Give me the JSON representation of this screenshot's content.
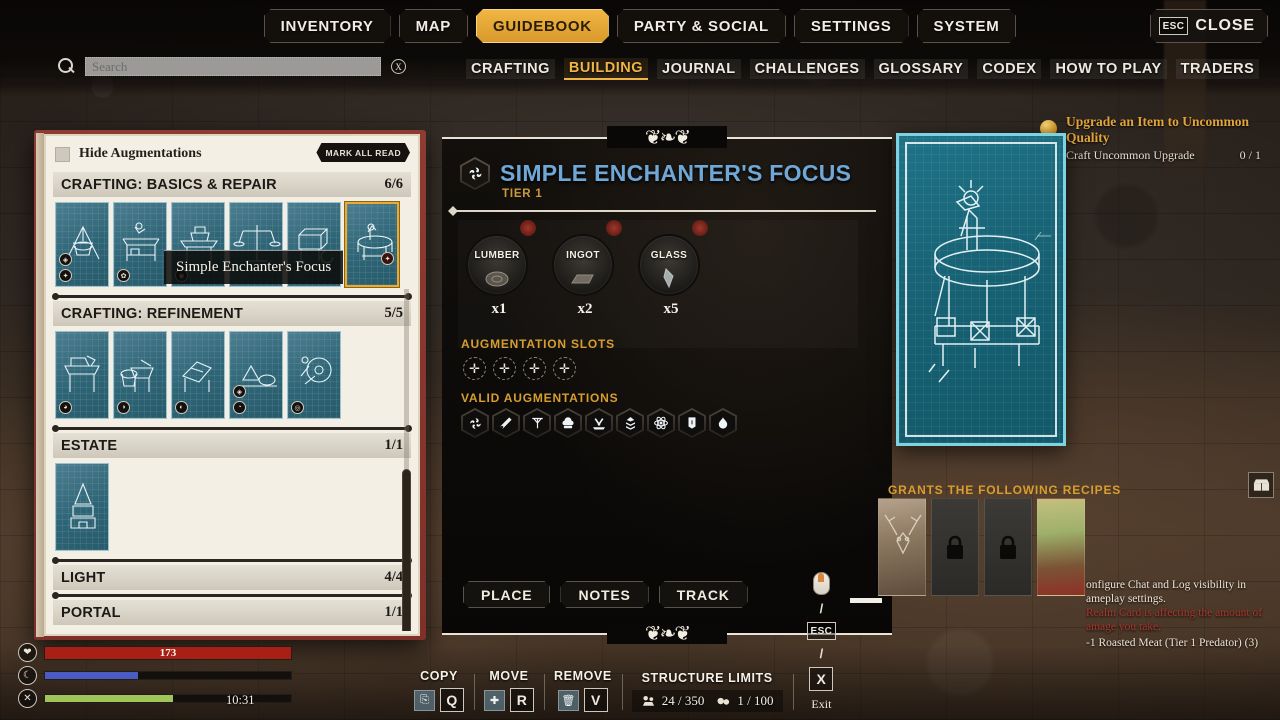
{
  "topmenu": {
    "items": [
      {
        "label": "INVENTORY",
        "active": false
      },
      {
        "label": "MAP",
        "active": false
      },
      {
        "label": "GUIDEBOOK",
        "active": true
      },
      {
        "label": "PARTY & SOCIAL",
        "active": false
      },
      {
        "label": "SETTINGS",
        "active": false
      },
      {
        "label": "SYSTEM",
        "active": false
      }
    ],
    "close_key": "ESC",
    "close_label": "CLOSE"
  },
  "search": {
    "placeholder": "Search",
    "value": "",
    "clear_label": "X",
    "icon": "search-icon"
  },
  "subtabs": [
    {
      "label": "CRAFTING",
      "active": false
    },
    {
      "label": "BUILDING",
      "active": true
    },
    {
      "label": "JOURNAL",
      "active": false
    },
    {
      "label": "CHALLENGES",
      "active": false
    },
    {
      "label": "GLOSSARY",
      "active": false
    },
    {
      "label": "CODEX",
      "active": false
    },
    {
      "label": "HOW TO PLAY",
      "active": false
    },
    {
      "label": "TRADERS",
      "active": false
    }
  ],
  "book": {
    "hide_augmentations_label": "Hide Augmentations",
    "mark_all_read_label": "MARK ALL READ",
    "tooltip": "Simple Enchanter's Focus",
    "categories": [
      {
        "name": "CRAFTING: BASICS & REPAIR",
        "count": "6/6",
        "cards": 6
      },
      {
        "name": "CRAFTING: REFINEMENT",
        "count": "5/5",
        "cards": 5
      },
      {
        "name": "ESTATE",
        "count": "1/1",
        "cards": 1
      },
      {
        "name": "LIGHT",
        "count": "4/4",
        "cards": 0
      },
      {
        "name": "PORTAL",
        "count": "1/1",
        "cards": 0
      }
    ]
  },
  "detail": {
    "title": "SIMPLE ENCHANTER'S FOCUS",
    "title_icon": "enchanter-focus-icon",
    "tier": "TIER 1",
    "ingredients": [
      {
        "name": "LUMBER",
        "qty": "x1"
      },
      {
        "name": "INGOT",
        "qty": "x2"
      },
      {
        "name": "GLASS",
        "qty": "x5"
      }
    ],
    "augmentation_slots_label": "AUGMENTATION SLOTS",
    "augmentation_slots": 4,
    "slot_glyph": "✛",
    "valid_augmentations_label": "VALID AUGMENTATIONS",
    "valid_augmentations": [
      "arcane-focus-icon",
      "weapon-icon",
      "construction-crane-icon",
      "cooking-icon",
      "butcher-icon",
      "tier-chevrons-icon",
      "atom-icon",
      "scroll-icon",
      "flame-icon"
    ],
    "actions": [
      {
        "label": "PLACE"
      },
      {
        "label": "NOTES"
      },
      {
        "label": "TRACK"
      }
    ],
    "recipes_label": "GRANTS THE FOLLOWING RECIPES",
    "recipes": [
      {
        "state": "unlocked",
        "art": "deer-skull"
      },
      {
        "state": "locked",
        "art": "lock"
      },
      {
        "state": "locked",
        "art": "lock"
      },
      {
        "state": "unlocked",
        "art": "landscape"
      }
    ]
  },
  "quest": {
    "title": "Upgrade an Item to Uncommon Quality",
    "objective": "Craft Uncommon Upgrade",
    "progress": "0 / 1",
    "icon": "quest-coin-icon",
    "accent": "#e2a43a"
  },
  "log": {
    "line1": "onfigure Chat and Log visibility in",
    "line1b": "ameplay settings.",
    "line2": "Realm Card is affecting the amount of",
    "line2b": "amage you take.",
    "line3": "-1 Roasted Meat (Tier 1 Predator) (3)",
    "warn_color": "#a8372c"
  },
  "crate_icon": "crate-icon",
  "hud": {
    "health": {
      "value": "173",
      "pct": 100,
      "color": "#a81f16",
      "icon": "heart-icon"
    },
    "stamina": {
      "pct": 38,
      "color": "#4a5cc4",
      "icon": "moon-icon"
    },
    "food": {
      "pct": 52,
      "color": "#9ec45a",
      "icon": "fork-knife-icon"
    },
    "clock": "10:31",
    "groups": [
      {
        "cap": "COPY",
        "icon": "copy-icon",
        "key": "Q"
      },
      {
        "cap": "MOVE",
        "icon": "move-icon",
        "key": "R"
      },
      {
        "cap": "REMOVE",
        "icon": "trash-icon",
        "key": "V"
      }
    ],
    "structure_limits_label": "STRUCTURE LIMITS",
    "limits": [
      {
        "icon": "structure-icon",
        "value": "24 / 350"
      },
      {
        "icon": "decor-icon",
        "value": "1 / 100"
      }
    ],
    "exit": {
      "mouse_icon": "mouse-icon",
      "sep": "/",
      "key_esc": "ESC",
      "key_x": "X",
      "label": "Exit"
    }
  }
}
